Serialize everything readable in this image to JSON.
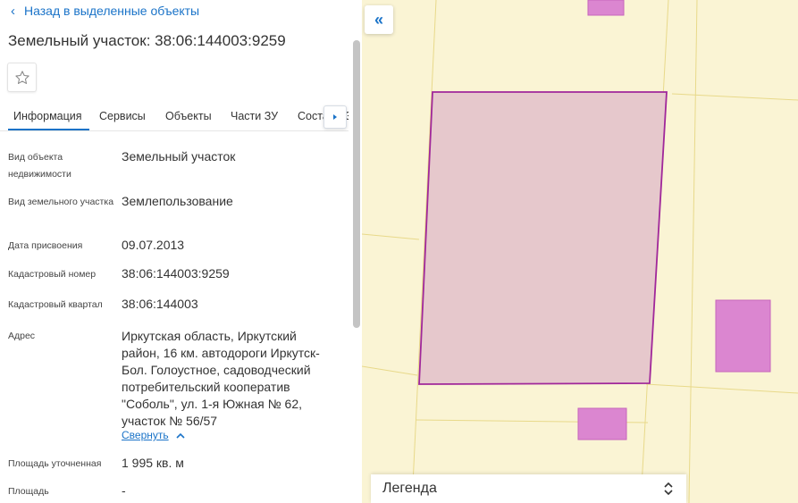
{
  "panel": {
    "back_label": "Назад в выделенные объекты",
    "title": "Земельный участок: 38:06:144003:9259",
    "tabs": [
      {
        "label": "Информация"
      },
      {
        "label": "Сервисы"
      },
      {
        "label": "Объекты"
      },
      {
        "label": "Части ЗУ"
      },
      {
        "label": "Состав ЕЗП"
      }
    ],
    "fields": [
      {
        "label": "Вид объекта недвижимости",
        "value": "Земельный участок"
      },
      {
        "label": "Вид земельного участка",
        "value": "Землепользование"
      },
      {
        "label": "Дата присвоения",
        "value": "09.07.2013"
      },
      {
        "label": "Кадастровый номер",
        "value": "38:06:144003:9259"
      },
      {
        "label": "Кадастровый квартал",
        "value": "38:06:144003"
      },
      {
        "label": "Адрес",
        "value": "Иркутская область, Иркутский район, 16 км. автодороги Иркутск-Бол. Голоустное, садоводческий потребительский кооператив \"Соболь\", ул. 1-я Южная № 62, участок № 56/57"
      },
      {
        "label": "Площадь уточненная",
        "value": "1 995 кв. м"
      },
      {
        "label": "Площадь",
        "value": "-"
      }
    ],
    "collapse_label": "Свернуть"
  },
  "map": {
    "legend_title": "Легенда"
  },
  "colors": {
    "accent": "#1a73c8",
    "map_bg": "#faf4d4",
    "parcel_fill": "#e6c8cc",
    "parcel_stroke": "#a0279a",
    "building_fill": "#db86d0"
  }
}
